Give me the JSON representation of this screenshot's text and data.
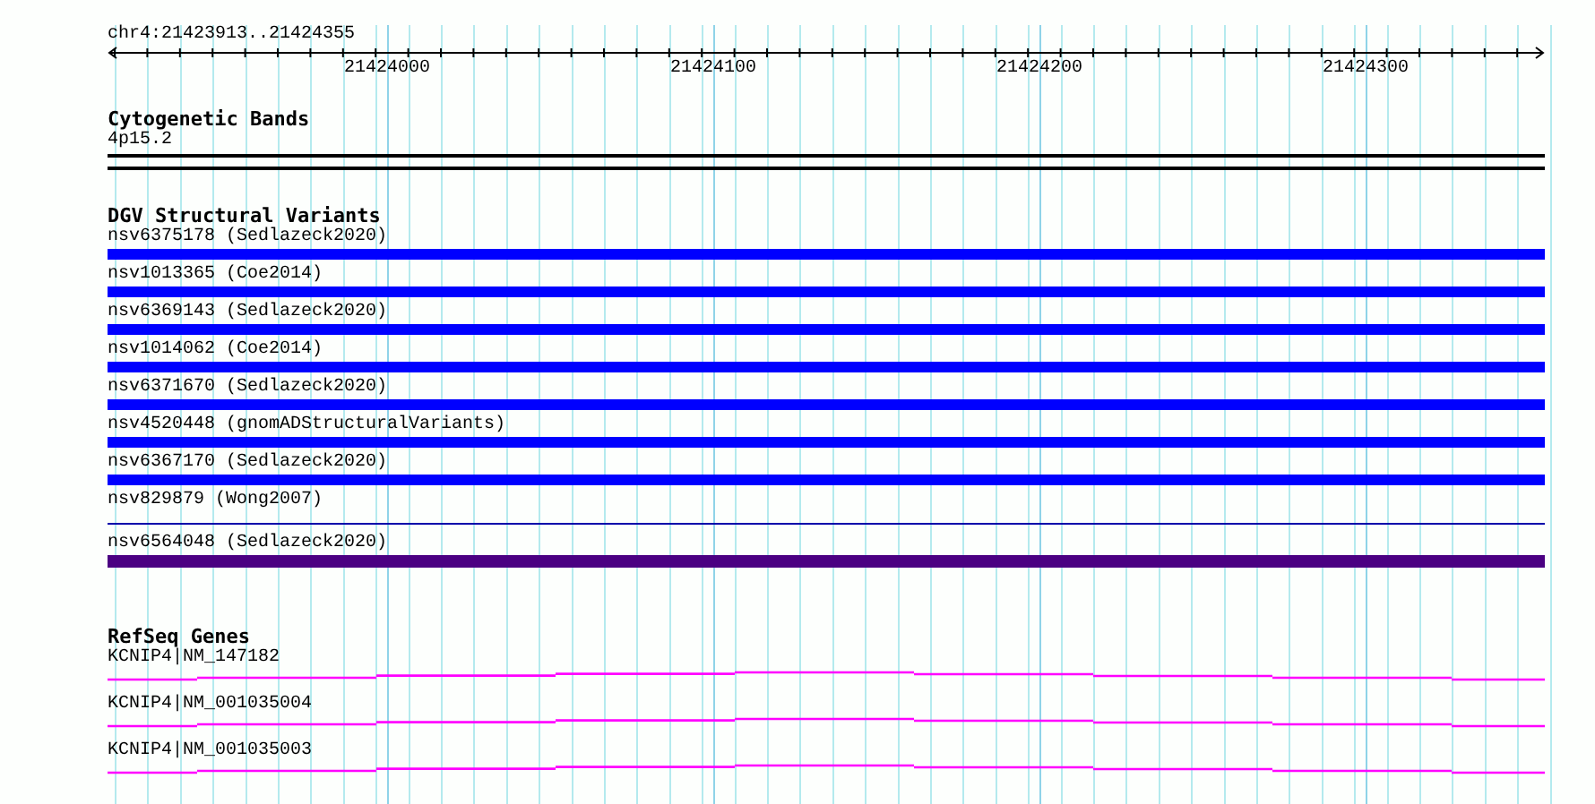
{
  "ruler": {
    "position": "chr4:21423913..21424355",
    "ticks": [
      "21424000",
      "21424100",
      "21424200",
      "21424300"
    ]
  },
  "cytogenetic_bands": {
    "title": "Cytogenetic Bands",
    "band": "4p15.2"
  },
  "dgv_structural_variants": {
    "title": "DGV Structural Variants",
    "items": [
      {
        "label": "nsv6375178 (Sedlazeck2020)",
        "kind": "thick",
        "color": "#0000ff"
      },
      {
        "label": "nsv1013365 (Coe2014)",
        "kind": "thick",
        "color": "#0000ff"
      },
      {
        "label": "nsv6369143 (Sedlazeck2020)",
        "kind": "thick",
        "color": "#0000ff"
      },
      {
        "label": "nsv1014062 (Coe2014)",
        "kind": "thick",
        "color": "#0000ff"
      },
      {
        "label": "nsv6371670 (Sedlazeck2020)",
        "kind": "thick",
        "color": "#0000ff"
      },
      {
        "label": "nsv4520448 (gnomADStructuralVariants)",
        "kind": "thick",
        "color": "#0000ff"
      },
      {
        "label": "nsv6367170 (Sedlazeck2020)",
        "kind": "thick",
        "color": "#0000ff"
      },
      {
        "label": "nsv829879 (Wong2007)",
        "kind": "thin",
        "color": "#0000aa"
      },
      {
        "label": "nsv6564048 (Sedlazeck2020)",
        "kind": "thick",
        "color": "#4b0082"
      }
    ]
  },
  "refseq_genes": {
    "title": "RefSeq Genes",
    "items": [
      {
        "label": "KCNIP4|NM_147182",
        "color": "#ff00ff"
      },
      {
        "label": "KCNIP4|NM_001035004",
        "color": "#ff00ff"
      },
      {
        "label": "KCNIP4|NM_001035003",
        "color": "#ff00ff"
      }
    ]
  }
}
